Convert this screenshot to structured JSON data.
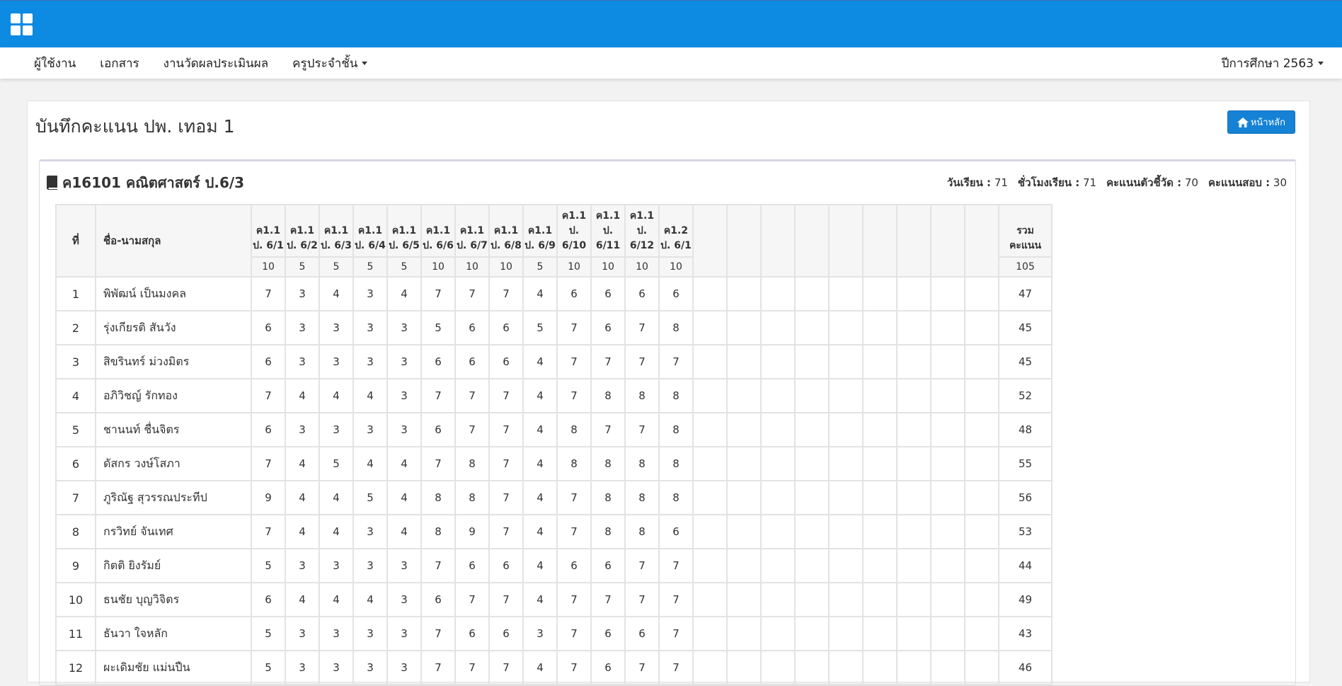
{
  "navbar": {
    "items": [
      "ผู้ใช้งาน",
      "เอกสาร",
      "งานวัดผลประเมินผล",
      "ครูประจำชั้น"
    ],
    "year_label": "ปีการศึกษา 2563"
  },
  "page": {
    "title": "บันทึกคะแนน ปพ. เทอม 1",
    "home_button": "หน้าหลัก"
  },
  "subject": {
    "title": "ค16101 คณิตศาสตร์ ป.6/3",
    "stats": [
      {
        "label": "วันเรียน :",
        "value": "71"
      },
      {
        "label": "ชั่วโมงเรียน :",
        "value": "71"
      },
      {
        "label": "คะแนนตัวชี้วัด :",
        "value": "70"
      },
      {
        "label": "คะแนนสอบ :",
        "value": "30"
      }
    ]
  },
  "table": {
    "no_header": "ที่",
    "name_header": "ชื่อ-นามสกุล",
    "indicators": [
      {
        "lines": [
          "ค1.1",
          "ป. 6/1"
        ],
        "max": "10"
      },
      {
        "lines": [
          "ค1.1",
          "ป. 6/2"
        ],
        "max": "5"
      },
      {
        "lines": [
          "ค1.1",
          "ป. 6/3"
        ],
        "max": "5"
      },
      {
        "lines": [
          "ค1.1",
          "ป. 6/4"
        ],
        "max": "5"
      },
      {
        "lines": [
          "ค1.1",
          "ป. 6/5"
        ],
        "max": "5"
      },
      {
        "lines": [
          "ค1.1",
          "ป. 6/6"
        ],
        "max": "10"
      },
      {
        "lines": [
          "ค1.1",
          "ป. 6/7"
        ],
        "max": "10"
      },
      {
        "lines": [
          "ค1.1",
          "ป. 6/8"
        ],
        "max": "10"
      },
      {
        "lines": [
          "ค1.1",
          "ป. 6/9"
        ],
        "max": "5"
      },
      {
        "lines": [
          "ค1.1",
          "ป.",
          "6/10"
        ],
        "max": "10"
      },
      {
        "lines": [
          "ค1.1",
          "ป.",
          "6/11"
        ],
        "max": "10"
      },
      {
        "lines": [
          "ค1.1",
          "ป.",
          "6/12"
        ],
        "max": "10"
      },
      {
        "lines": [
          "ค1.2",
          "ป. 6/1"
        ],
        "max": "10"
      }
    ],
    "empty_columns": 9,
    "total_header": [
      "รวม",
      "คะแนน"
    ],
    "total_max": "105",
    "rows": [
      {
        "no": "1",
        "name": "พิพัฒน์ เป็นมงคล",
        "scores": [
          "7",
          "3",
          "4",
          "3",
          "4",
          "7",
          "7",
          "7",
          "4",
          "6",
          "6",
          "6",
          "6"
        ],
        "total": "47"
      },
      {
        "no": "2",
        "name": "รุ่งเกียรติ สันวัง",
        "scores": [
          "6",
          "3",
          "3",
          "3",
          "3",
          "5",
          "6",
          "6",
          "5",
          "7",
          "6",
          "7",
          "8"
        ],
        "total": "45"
      },
      {
        "no": "3",
        "name": "สิขรินทร์ ม่วงมิตร",
        "scores": [
          "6",
          "3",
          "3",
          "3",
          "3",
          "6",
          "6",
          "6",
          "4",
          "7",
          "7",
          "7",
          "7"
        ],
        "total": "45"
      },
      {
        "no": "4",
        "name": "อภิวิชญ์ รักทอง",
        "scores": [
          "7",
          "4",
          "4",
          "4",
          "3",
          "7",
          "7",
          "7",
          "4",
          "7",
          "8",
          "8",
          "8"
        ],
        "total": "52"
      },
      {
        "no": "5",
        "name": "ชานนท์ ชื่นจิตร",
        "scores": [
          "6",
          "3",
          "3",
          "3",
          "3",
          "6",
          "7",
          "7",
          "4",
          "8",
          "7",
          "7",
          "8"
        ],
        "total": "48"
      },
      {
        "no": "6",
        "name": "ดัสกร วงษ์โสภา",
        "scores": [
          "7",
          "4",
          "5",
          "4",
          "4",
          "7",
          "8",
          "7",
          "4",
          "8",
          "8",
          "8",
          "8"
        ],
        "total": "55"
      },
      {
        "no": "7",
        "name": "ภูริณัฐ สุวรรณประทีป",
        "scores": [
          "9",
          "4",
          "4",
          "5",
          "4",
          "8",
          "8",
          "7",
          "4",
          "7",
          "8",
          "8",
          "8"
        ],
        "total": "56"
      },
      {
        "no": "8",
        "name": "กรวิทย์ จันเทศ",
        "scores": [
          "7",
          "4",
          "4",
          "3",
          "4",
          "8",
          "9",
          "7",
          "4",
          "7",
          "8",
          "8",
          "6"
        ],
        "total": "53"
      },
      {
        "no": "9",
        "name": "กิตติ ยิงรัมย์",
        "scores": [
          "5",
          "3",
          "3",
          "3",
          "3",
          "7",
          "6",
          "6",
          "4",
          "6",
          "6",
          "7",
          "7"
        ],
        "total": "44"
      },
      {
        "no": "10",
        "name": "ธนชัย บุญวิจิตร",
        "scores": [
          "6",
          "4",
          "4",
          "4",
          "3",
          "6",
          "7",
          "7",
          "4",
          "7",
          "7",
          "7",
          "7"
        ],
        "total": "49"
      },
      {
        "no": "11",
        "name": "ธันวา ใจหลัก",
        "scores": [
          "5",
          "3",
          "3",
          "3",
          "3",
          "7",
          "6",
          "6",
          "3",
          "7",
          "6",
          "6",
          "7"
        ],
        "total": "43"
      },
      {
        "no": "12",
        "name": "ผะเดิมชัย แม่นปืน",
        "scores": [
          "5",
          "3",
          "3",
          "3",
          "3",
          "7",
          "7",
          "7",
          "4",
          "7",
          "6",
          "7",
          "7"
        ],
        "total": "46"
      }
    ]
  }
}
